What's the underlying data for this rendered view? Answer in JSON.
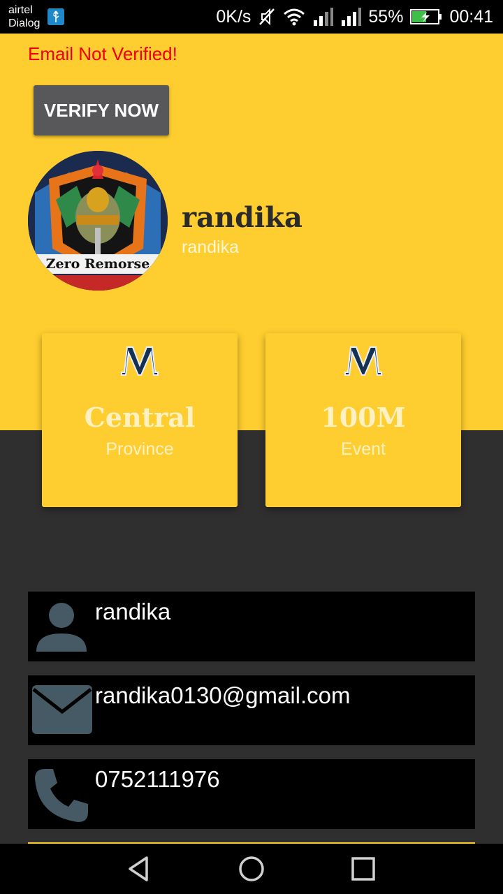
{
  "status_bar": {
    "carrier_line1": "airtel",
    "carrier_line2": "Dialog",
    "net_speed": "0K/s",
    "battery_percent": "55%",
    "time": "00:41"
  },
  "header": {
    "email_warning": "Email Not Verified!",
    "verify_button": "VERIFY NOW",
    "avatar_text": "Zero Remorse",
    "display_name": "randika",
    "username": "randika"
  },
  "cards": [
    {
      "value": "Central",
      "label": "Province",
      "icon": "m-logo-icon"
    },
    {
      "value": "100M",
      "label": "Event",
      "icon": "m-logo-icon"
    }
  ],
  "info": {
    "name": "randika",
    "email": "randika0130@gmail.com",
    "phone": "0752111976"
  },
  "colors": {
    "accent": "#fecd2f",
    "background": "#2f2f2f",
    "warning": "#f00000",
    "button": "#58585a",
    "icon_gray": "#455a64"
  }
}
